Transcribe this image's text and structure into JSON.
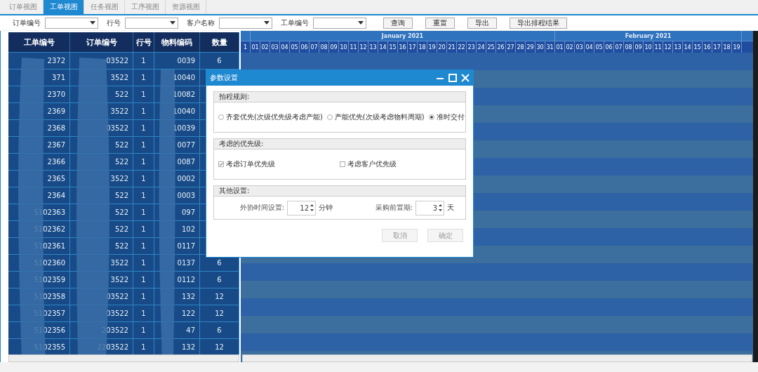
{
  "tabs": [
    {
      "label": "订单视图",
      "selected": false
    },
    {
      "label": "工单视图",
      "selected": true
    },
    {
      "label": "任务视图",
      "selected": false
    },
    {
      "label": "工序视图",
      "selected": false
    },
    {
      "label": "资源视图",
      "selected": false
    }
  ],
  "filters": [
    {
      "label": "订单编号"
    },
    {
      "label": "行号"
    },
    {
      "label": "客户名称"
    },
    {
      "label": "工单编号"
    }
  ],
  "buttons": [
    "查询",
    "重置",
    "导出",
    "导出排程结果"
  ],
  "table": {
    "columns": [
      "工单编号",
      "订单编号",
      "行号",
      "物料编码",
      "数量"
    ],
    "rows": [
      [
        "2372",
        "03522",
        "1",
        "0039",
        "6"
      ],
      [
        "371",
        "3522",
        "1",
        "10040",
        null
      ],
      [
        "2370",
        "522",
        "1",
        "10082",
        null
      ],
      [
        "2369",
        "3522",
        "1",
        "10040",
        null
      ],
      [
        "2368",
        "03522",
        "1",
        "10039",
        null
      ],
      [
        "2367",
        "522",
        "1",
        "0077",
        null
      ],
      [
        "2366",
        "522",
        "1",
        "0087",
        null
      ],
      [
        "2365",
        "3522",
        "1",
        "0002",
        null
      ],
      [
        "2364",
        "522",
        "1",
        "0003",
        null
      ],
      [
        "5102363",
        "522",
        "1",
        "097",
        null
      ],
      [
        "5102362",
        "522",
        "1",
        "102",
        null
      ],
      [
        "5102361",
        "522",
        "1",
        "0117",
        null
      ],
      [
        "5102360",
        "3522",
        "1",
        "0137",
        "6"
      ],
      [
        "5102359",
        "3522",
        "1",
        "0112",
        "6"
      ],
      [
        "5102358",
        "03522",
        "1",
        "132",
        "12"
      ],
      [
        "5102357",
        "03522",
        "1",
        "122",
        "12"
      ],
      [
        "5102356",
        "203522",
        "1",
        "47",
        "6"
      ],
      [
        "5102355",
        "2203522",
        "1",
        "132",
        "12"
      ]
    ]
  },
  "timeline": {
    "months": [
      {
        "days": [
          "1"
        ]
      },
      {
        "label": "January 2021",
        "days": [
          "01",
          "02",
          "03",
          "04",
          "05",
          "06",
          "07",
          "08",
          "09",
          "10",
          "11",
          "12",
          "13",
          "14",
          "15",
          "16",
          "17",
          "18",
          "19",
          "20",
          "21",
          "22",
          "23",
          "24",
          "25",
          "26",
          "27",
          "28",
          "29",
          "30",
          "31"
        ]
      },
      {
        "label": "February 2021",
        "days": [
          "01",
          "02",
          "03",
          "04",
          "05",
          "06",
          "07",
          "08",
          "09",
          "10",
          "11",
          "12",
          "13",
          "14",
          "15",
          "16",
          "17",
          "18",
          "19"
        ]
      }
    ]
  },
  "dialog": {
    "title": "参数设置",
    "rules": {
      "title": "拍程规则:",
      "options": [
        {
          "label": "齐套优先(次级优先级考虑产能)",
          "selected": false
        },
        {
          "label": "产能优先(次级考虑物料周期)",
          "selected": false
        },
        {
          "label": "准时交付",
          "selected": true
        }
      ]
    },
    "priority": {
      "title": "考虑的优先级:",
      "options": [
        {
          "label": "考虑订单优先级",
          "checked": true
        },
        {
          "label": "考虑客户优先级",
          "checked": false
        }
      ]
    },
    "other": {
      "title": "其他设置:",
      "fields": [
        {
          "label": "外协时间设置:",
          "value": "12",
          "unit": "分钟"
        },
        {
          "label": "采购前置期:",
          "value": "3",
          "unit": "天"
        }
      ]
    },
    "buttons": [
      "取消",
      "确定"
    ]
  }
}
